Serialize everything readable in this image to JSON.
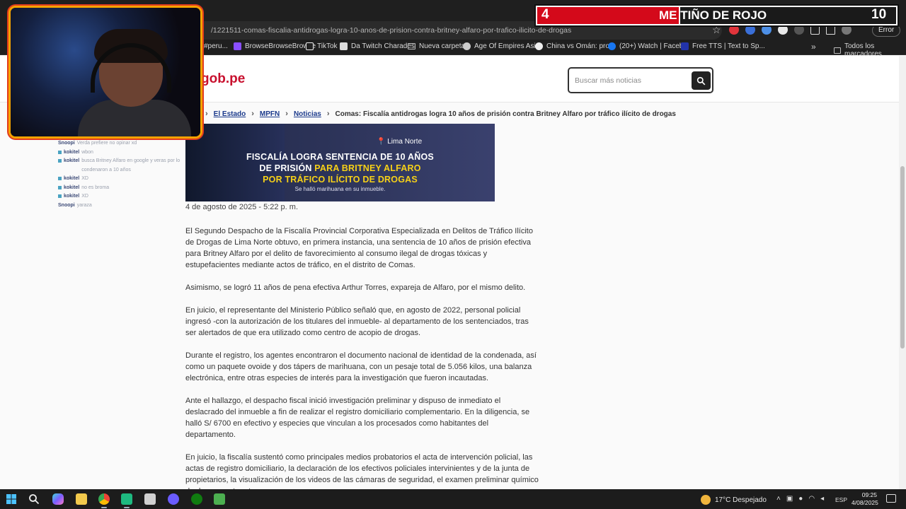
{
  "browser": {
    "url": "/1221511-comas-fiscalia-antidrogas-logra-10-anos-de-prision-contra-britney-alfaro-por-trafico-ilicito-de-drogas",
    "error_label": "Error",
    "bookmarks": [
      "#peru...",
      "BrowseBrowseBrowse",
      "TikTok",
      "Da Twitch Charades",
      "Nueva carpeta",
      "Age Of Empires Asi...",
      "China vs Omán: pro...",
      "(20+) Watch | Faceb...",
      "Free TTS | Text to Sp..."
    ],
    "all_bookmarks": "Todos los marcadores"
  },
  "site": {
    "logo": "gob.pe",
    "search_placeholder": "Buscar más noticias"
  },
  "breadcrumb": {
    "items": [
      "El Estado",
      "MPFN",
      "Noticias"
    ],
    "current": "Comas: Fiscalía antidrogas logra 10 años de prisión contra Britney Alfaro por tráfico ilícito de drogas"
  },
  "banner": {
    "location": "Lima Norte",
    "line1": "FISCALÍA LOGRA SENTENCIA DE 10 AÑOS",
    "line2a": "DE PRISIÓN",
    "line2b": "PARA BRITNEY ALFARO",
    "line3": "POR TRÁFICO ILÍCITO DE DROGAS",
    "subtitle": "Se halló marihuana en su inmueble."
  },
  "article": {
    "date": "4 de agosto de 2025 - 5:22 p. m.",
    "paragraphs": [
      "El Segundo Despacho de la Fiscalía Provincial Corporativa Especializada en Delitos de Tráfico Ilícito de Drogas de Lima Norte obtuvo, en primera instancia, una sentencia de 10 años de prisión efectiva para Britney Alfaro por el delito de favorecimiento al consumo ilegal de drogas tóxicas y estupefacientes mediante actos de tráfico, en el distrito de Comas.",
      "Asimismo, se logró 11 años de pena efectiva Arthur Torres, expareja de Alfaro, por el mismo delito.",
      "En juicio, el representante del Ministerio Público señaló que, en agosto de 2022, personal policial ingresó -con la autorización de los titulares del inmueble- al departamento de los sentenciados, tras ser alertados de que era utilizado como centro de acopio de drogas.",
      "Durante el registro, los agentes encontraron el documento nacional de identidad de la condenada, así como un paquete ovoide y dos tápers de marihuana, con un pesaje total de 5.056 kilos, una balanza electrónica, entre otras especies de interés para la investigación que fueron incautadas.",
      "Ante el hallazgo, el despacho fiscal inició investigación preliminar y dispuso de inmediato el deslacrado del inmueble a fin de realizar el registro domiciliario complementario. En la diligencia, se halló S/ 6700 en efectivo y especies que vinculan a los procesados como habitantes del departamento.",
      "En juicio, la fiscalía sustentó como principales medios probatorios el acta de intervención policial, las actas de registro domiciliario, la declaración de los efectivos policiales intervinientes y de la junta de propietarios, la visualización de los videos de las cámaras de seguridad, el examen preliminar químico de drogas, entre otros."
    ]
  },
  "chat": [
    {
      "user": "Snoopi",
      "msg": "Verda prefiere no opinar xd"
    },
    {
      "user": "kokitel",
      "msg": "wbon"
    },
    {
      "user": "kokitel",
      "msg": "busca Britney Alfaro en google y veras por lo condenaron a 10 años"
    },
    {
      "user": "kokitel",
      "msg": "XD"
    },
    {
      "user": "kokitel",
      "msg": "no es broma"
    },
    {
      "user": "kokitel",
      "msg": "XD"
    },
    {
      "user": "Snoopi",
      "msg": "yaraza"
    }
  ],
  "overlay": {
    "left_number": "4",
    "text": "ME TIÑO DE ROJO",
    "right_number": "10"
  },
  "taskbar": {
    "weather": "17°C Despejado",
    "lang": "ESP",
    "time": "09:25",
    "date": "4/08/2025"
  }
}
